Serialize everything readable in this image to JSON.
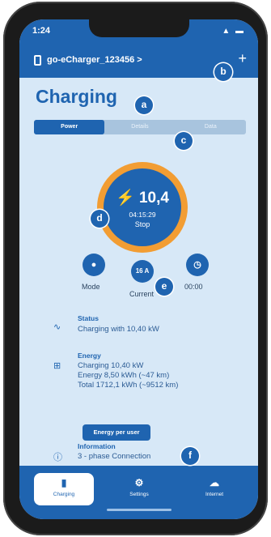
{
  "status_bar": {
    "time": "1:24",
    "signal": "▲ ▬"
  },
  "app_bar": {
    "device_name": "go-eCharger_123456 >",
    "add_label": "+"
  },
  "page": {
    "title": "Charging"
  },
  "tabs": [
    {
      "label": "Power"
    },
    {
      "label": "Details"
    },
    {
      "label": "Data"
    }
  ],
  "gauge": {
    "icon": "bolt-icon",
    "power": "⚡ 10,4",
    "timer": "04:15:29",
    "stop_label": "Stop",
    "accent": "#f29d33"
  },
  "controls": [
    {
      "label": "Mode",
      "glyph": "●",
      "icon": "mode-icon"
    },
    {
      "label": "Current",
      "glyph": "16 A",
      "icon": "current-icon"
    },
    {
      "label": "00:00",
      "glyph": "◷",
      "icon": "timer-icon"
    }
  ],
  "status": {
    "title": "Status",
    "text": "Charging with 10,40 kW",
    "icon_glyph": "∿"
  },
  "energy": {
    "title": "Energy",
    "icon_glyph": "⊞",
    "lines": [
      "Charging 10,40 kW",
      "Energy 8,50 kWh (~47 km)",
      "Total 1712,1 kWh (~9512 km)"
    ],
    "button": "Energy per user"
  },
  "information": {
    "title": "Information",
    "text": "3 - phase Connection",
    "icon_glyph": "ⓘ"
  },
  "nav": [
    {
      "label": "Charging",
      "glyph": "▮",
      "icon": "charger-icon"
    },
    {
      "label": "Settings",
      "glyph": "⚙",
      "icon": "gear-icon"
    },
    {
      "label": "Internet",
      "glyph": "☁",
      "icon": "cloud-icon"
    }
  ],
  "badges": [
    "a",
    "b",
    "c",
    "d",
    "e",
    "f"
  ],
  "colors": {
    "primary": "#1f64b0",
    "background": "#d7e8f7",
    "accent": "#f29d33"
  }
}
